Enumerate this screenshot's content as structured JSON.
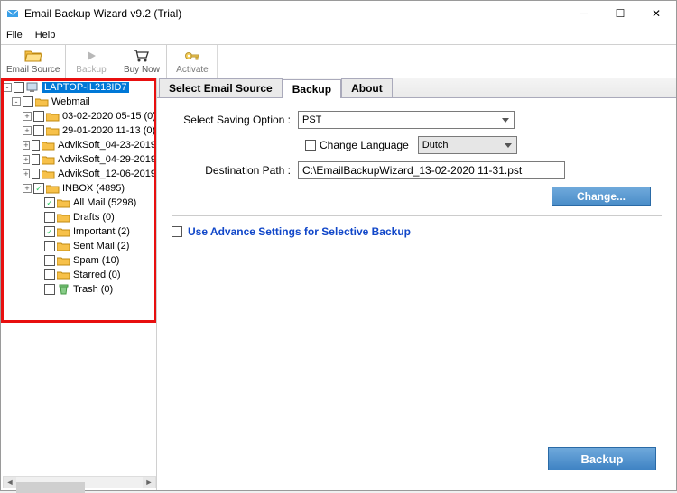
{
  "window": {
    "title": "Email Backup Wizard v9.2 (Trial)"
  },
  "menu": {
    "file": "File",
    "help": "Help"
  },
  "toolbar": {
    "emailSource": "Email Source",
    "backup": "Backup",
    "buyNow": "Buy Now",
    "activate": "Activate"
  },
  "tree": {
    "root": "LAPTOP-IL218ID7",
    "webmail": "Webmail",
    "items": [
      {
        "label": "03-02-2020 05-15 (0)",
        "expandable": true,
        "checked": false
      },
      {
        "label": "29-01-2020 11-13 (0)",
        "expandable": true,
        "checked": false
      },
      {
        "label": "AdvikSoft_04-23-2019",
        "expandable": true,
        "checked": false
      },
      {
        "label": "AdvikSoft_04-29-2019",
        "expandable": true,
        "checked": false
      },
      {
        "label": "AdvikSoft_12-06-2019",
        "expandable": true,
        "checked": false
      },
      {
        "label": "INBOX (4895)",
        "expandable": true,
        "checked": true
      },
      {
        "label": "All Mail (5298)",
        "expandable": false,
        "checked": true
      },
      {
        "label": "Drafts (0)",
        "expandable": false,
        "checked": false
      },
      {
        "label": "Important (2)",
        "expandable": false,
        "checked": true
      },
      {
        "label": "Sent Mail (2)",
        "expandable": false,
        "checked": false
      },
      {
        "label": "Spam (10)",
        "expandable": false,
        "checked": false
      },
      {
        "label": "Starred (0)",
        "expandable": false,
        "checked": false
      },
      {
        "label": "Trash (0)",
        "expandable": false,
        "checked": false,
        "trash": true
      }
    ]
  },
  "tabs": {
    "selectEmailSource": "Select Email Source",
    "backup": "Backup",
    "about": "About"
  },
  "form": {
    "savingOptionLabel": "Select Saving Option :",
    "savingOptionValue": "PST",
    "changeLanguageLabel": "Change Language",
    "languageValue": "Dutch",
    "destinationLabel": "Destination Path :",
    "destinationValue": "C:\\EmailBackupWizard_13-02-2020 11-31.pst",
    "changeBtn": "Change...",
    "advanceLabel": "Use Advance Settings for Selective Backup",
    "backupBtn": "Backup"
  }
}
